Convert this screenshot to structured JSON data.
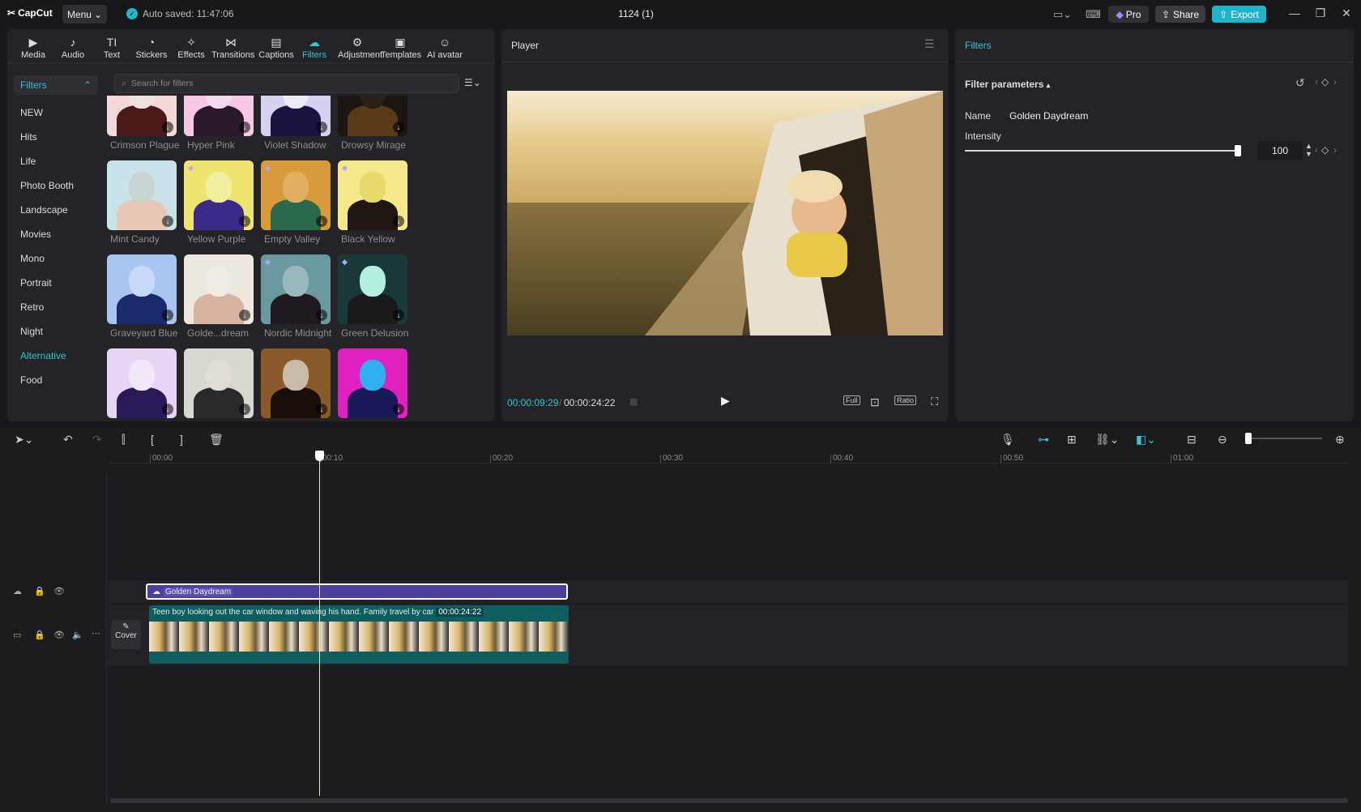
{
  "app": {
    "logo": "CapCut",
    "menu_label": "Menu",
    "autosave": "Auto saved: 11:47:06",
    "project_title": "1124 (1)",
    "pro_label": "Pro",
    "share_label": "Share",
    "export_label": "Export",
    "accent": "#20b4c8"
  },
  "toolbar": {
    "items": [
      {
        "label": "Media",
        "icon": "media-icon"
      },
      {
        "label": "Audio",
        "icon": "audio-icon"
      },
      {
        "label": "Text",
        "icon": "text-icon"
      },
      {
        "label": "Stickers",
        "icon": "stickers-icon"
      },
      {
        "label": "Effects",
        "icon": "effects-icon"
      },
      {
        "label": "Transitions",
        "icon": "transitions-icon"
      },
      {
        "label": "Captions",
        "icon": "captions-icon"
      },
      {
        "label": "Filters",
        "icon": "filters-icon",
        "active": true
      },
      {
        "label": "Adjustment",
        "icon": "adjustment-icon"
      },
      {
        "label": "Templates",
        "icon": "templates-icon"
      },
      {
        "label": "AI avatar",
        "icon": "ai-avatar-icon"
      }
    ]
  },
  "filters_panel": {
    "category_header": "Filters",
    "categories": [
      "NEW",
      "Hits",
      "Life",
      "Photo Booth",
      "Landscape",
      "Movies",
      "Mono",
      "Portrait",
      "Retro",
      "Night",
      "Alternative",
      "Food"
    ],
    "active_category": "Alternative",
    "search_placeholder": "Search for filters",
    "filters": [
      {
        "name": "Crimson Plague"
      },
      {
        "name": "Hyper Pink"
      },
      {
        "name": "Violet Shadow"
      },
      {
        "name": "Drowsy Mirage"
      },
      {
        "name": "Mint Candy"
      },
      {
        "name": "Yellow Purple"
      },
      {
        "name": "Empty Valley"
      },
      {
        "name": "Black Yellow"
      },
      {
        "name": "Graveyard Blue"
      },
      {
        "name": "Golde...dream"
      },
      {
        "name": "Nordic Midnight"
      },
      {
        "name": "Green Delusion"
      }
    ]
  },
  "player": {
    "title": "Player",
    "current_time": "00:00:09:29",
    "total_time": "00:00:24:22",
    "full_label": "Full",
    "ratio_label": "Ratio"
  },
  "filter_params": {
    "panel_title": "Filters",
    "section_title": "Filter parameters",
    "name_label": "Name",
    "name_value": "Golden Daydream",
    "intensity_label": "Intensity",
    "intensity_value": "100",
    "intensity_fraction": 1.0
  },
  "timeline": {
    "ruler": [
      "00:00",
      "00:10",
      "00:20",
      "00:30",
      "00:40",
      "00:50",
      "01:00"
    ],
    "filter_clip_label": "Golden Daydream",
    "video_clip_caption": "Teen boy looking out the car window and waving his hand. Family travel by car",
    "video_clip_duration": "00:00:24:22",
    "cover_label": "Cover"
  }
}
